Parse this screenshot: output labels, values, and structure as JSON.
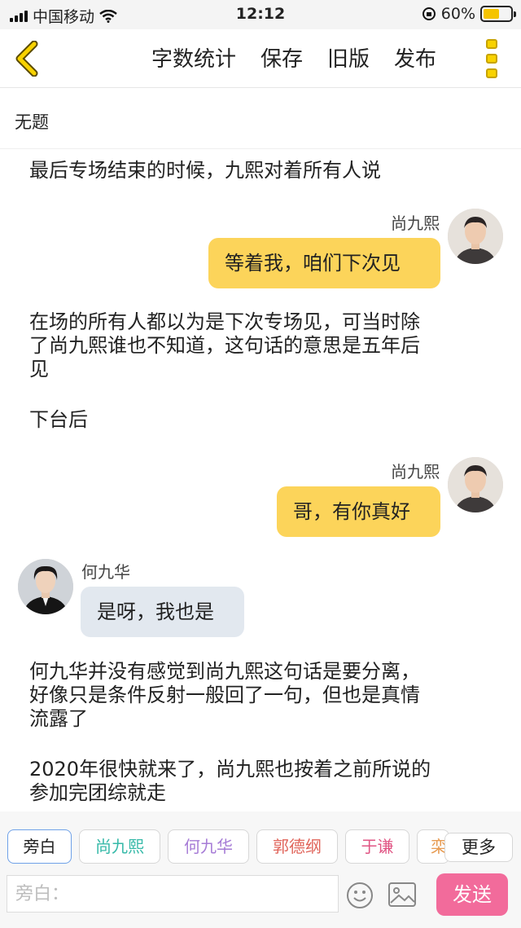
{
  "status_bar": {
    "carrier": "中国移动",
    "time": "12:12",
    "battery": "60%",
    "battery_level": 0.6
  },
  "nav": {
    "word_count": "字数统计",
    "save": "保存",
    "old_version": "旧版",
    "publish": "发布",
    "accent_color": "#f8d200"
  },
  "doc": {
    "title": "无题"
  },
  "story": {
    "n1": "最后专场结束的时候，九熙对着所有人说",
    "m1_name": "尚九熙",
    "m1_text": "等着我，咱们下次见",
    "n2_l1": "在场的所有人都以为是下次专场见，可当时除",
    "n2_l2": "了尚九熙谁也不知道，这句话的意思是五年后",
    "n2_l3": "见",
    "n3": "下台后",
    "m2_name": "尚九熙",
    "m2_text": "哥，有你真好",
    "m3_name": "何九华",
    "m3_text": "是呀，我也是",
    "n4_l1": "何九华并没有感觉到尚九熙这句话是要分离，",
    "n4_l2": "好像只是条件反射一般回了一句，但也是真情",
    "n4_l3": "流露了",
    "n5_l1": "2020年很快就来了，尚九熙也按着之前所说的",
    "n5_l2": "参加完团综就走"
  },
  "characters": {
    "chip_narrator": "旁白",
    "chip_1": "尚九熙",
    "chip_2": "何九华",
    "chip_3": "郭德纲",
    "chip_4": "于谦",
    "chip_5": "栾",
    "more": "更多",
    "colors": [
      "#222222",
      "#35b9a8",
      "#a67bd6",
      "#e0645a",
      "#e05584",
      "#e79b52"
    ]
  },
  "composer": {
    "placeholder": "旁白：",
    "send": "发送",
    "send_color": "#f26b9b"
  }
}
